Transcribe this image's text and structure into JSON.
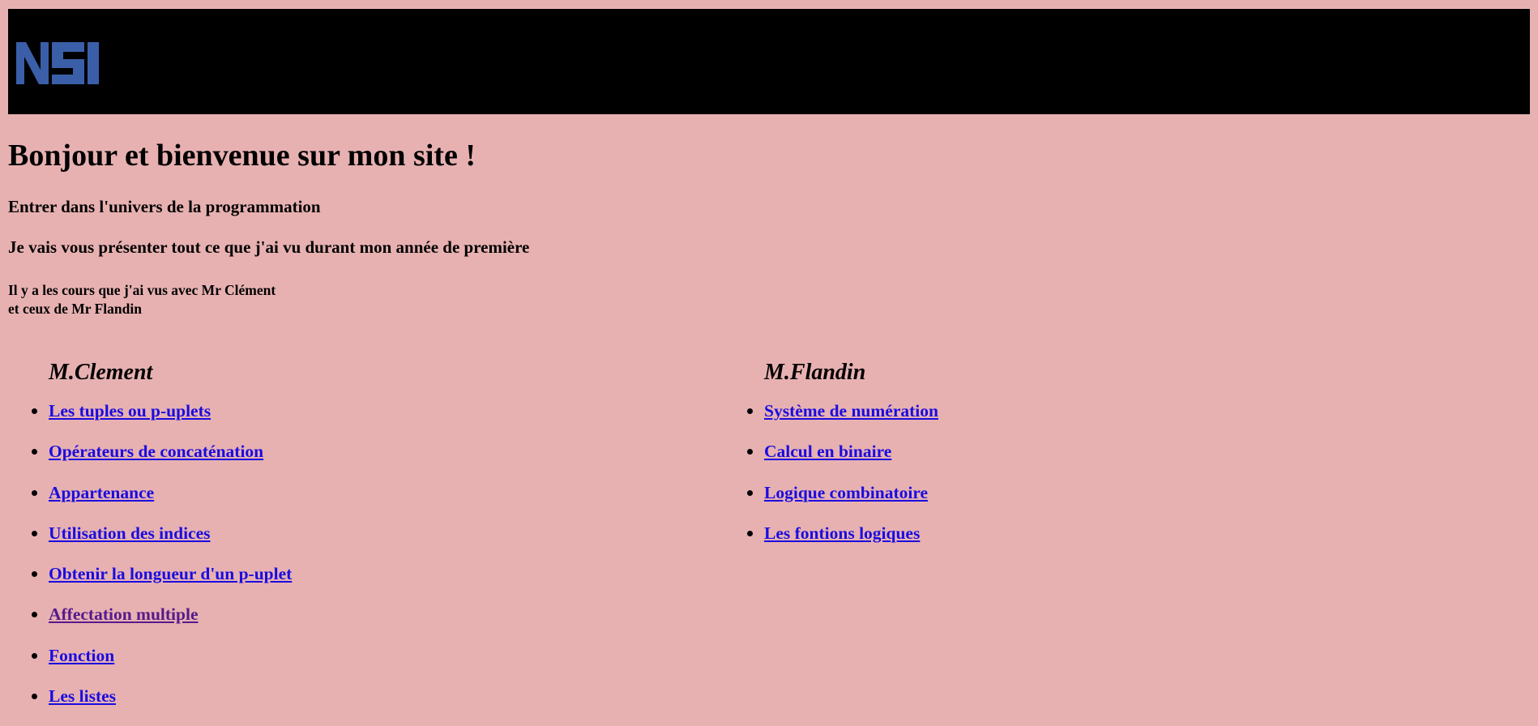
{
  "header": {
    "logo_text": "NSI",
    "logo_color": "#3a5fa8",
    "background": "#000000"
  },
  "page": {
    "background": "#e8b1b1",
    "title": "Bonjour et bienvenue sur mon site !",
    "subtitle1": "Entrer dans l'univers de la programmation",
    "subtitle2": "Je vais vous présenter tout ce que j'ai vu durant mon année de première",
    "intro_line1": "Il y a les cours que j'ai vus avec Mr Clément",
    "intro_line2": "et ceux de Mr Flandin"
  },
  "columns": {
    "left": {
      "heading": "M.Clement",
      "links": [
        "Les tuples ou p-uplets",
        "Opérateurs de concaténation",
        "Appartenance",
        "Utilisation des indices",
        "Obtenir la longueur d'un p-uplet",
        "Affectation multiple",
        "Fonction",
        "Les listes"
      ]
    },
    "right": {
      "heading": "M.Flandin",
      "links": [
        "Système de numération",
        "Calcul en binaire",
        "Logique combinatoire",
        "Les fontions logiques"
      ]
    }
  },
  "colors": {
    "link": "#1a0ce0",
    "link_visited": "#551a8b"
  }
}
